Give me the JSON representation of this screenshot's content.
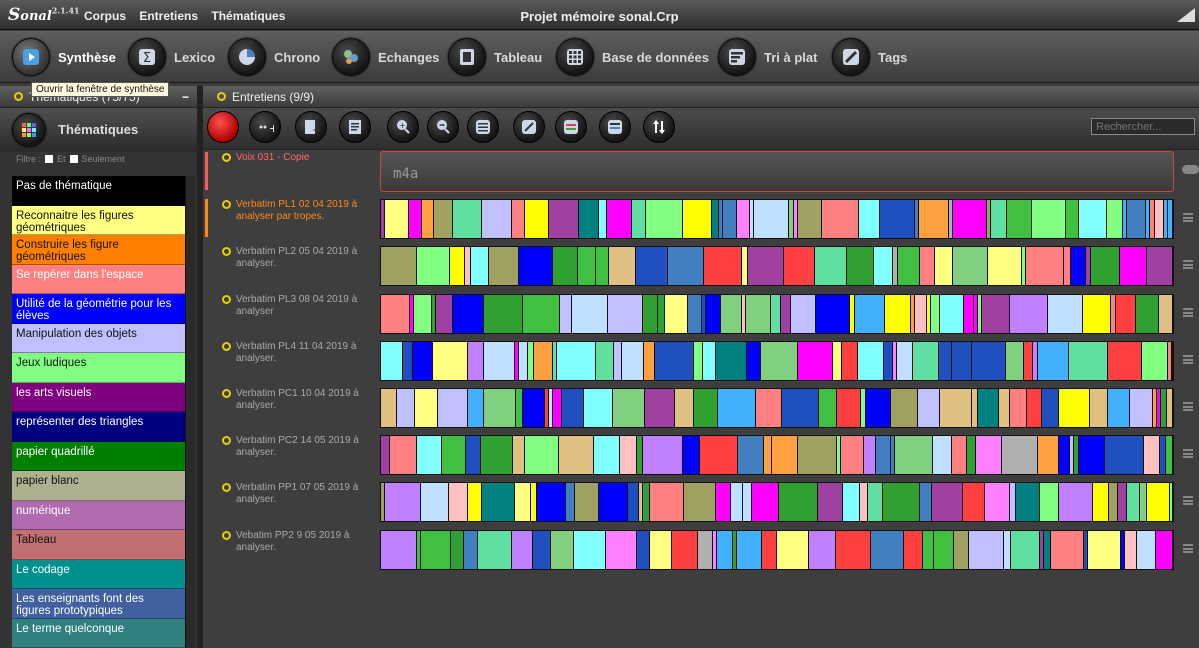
{
  "app": {
    "logo_s": "S",
    "logo_rest": "onal",
    "version": "2.1.41",
    "window_title": "Projet mémoire sonal.Crp",
    "menu": [
      "Corpus",
      "Entretiens",
      "Thématiques"
    ]
  },
  "toolbar": {
    "items": [
      {
        "label": "Synthèse",
        "icon": "synthese-icon",
        "active": true
      },
      {
        "label": "Lexico",
        "icon": "sigma-icon"
      },
      {
        "label": "Chrono",
        "icon": "chrono-pie-icon"
      },
      {
        "label": "Echanges",
        "icon": "people-icon"
      },
      {
        "label": "Tableau",
        "icon": "table-icon"
      },
      {
        "label": "Base de données",
        "icon": "database-grid-icon"
      },
      {
        "label": "Tri à plat",
        "icon": "bars-sort-icon"
      },
      {
        "label": "Tags",
        "icon": "tag-pen-icon"
      }
    ],
    "tooltip": "Ouvrir la fenêtre de synthèse"
  },
  "left_panel": {
    "header": "Thématiques (75/75)",
    "subheader": "Thématiques",
    "filter_label": "Filtre :",
    "filter_and": "Et",
    "filter_only": "Seulement",
    "themes": [
      {
        "label": "Pas de thématique",
        "color": "#000000"
      },
      {
        "label": "Reconnaitre les figures géométriques",
        "color": "#ffff80",
        "dark": true
      },
      {
        "label": "Construire les figure géométriques",
        "color": "#ff8000",
        "dark": true
      },
      {
        "label": "Se repérer dans l'espace",
        "color": "#ff8080"
      },
      {
        "label": "Utilité de la géométrie pour les élèves",
        "color": "#0000ff"
      },
      {
        "label": "Manipulation des objets",
        "color": "#c0c0ff",
        "dark": true
      },
      {
        "label": "Jeux ludiques",
        "color": "#80ff80",
        "dark": true
      },
      {
        "label": "les arts visuels",
        "color": "#800080"
      },
      {
        "label": "représenter des triangles",
        "color": "#000080"
      },
      {
        "label": "papier quadrillé",
        "color": "#008000"
      },
      {
        "label": "papier blanc",
        "color": "#b0b090",
        "dark": true
      },
      {
        "label": "numérique",
        "color": "#b06ab0"
      },
      {
        "label": "Tableau",
        "color": "#c07070",
        "dark": true
      },
      {
        "label": "Le codage",
        "color": "#009090"
      },
      {
        "label": "Les enseignants font des figures prototypiques",
        "color": "#4060a0"
      },
      {
        "label": "Le terme quelconque",
        "color": "#308080"
      }
    ]
  },
  "main_panel": {
    "header": "Entretiens (9/9)",
    "search_placeholder": "Rechercher...",
    "tools": [
      "record-icon",
      "add-interview-icon",
      "import-icon",
      "document-icon",
      "zoom-in-icon",
      "zoom-out-icon",
      "list-view-icon",
      "edit-view-icon",
      "expand-view-icon",
      "compact-view-icon",
      "sort-icon"
    ],
    "interviews": [
      {
        "label": "Voix 031 - Copie",
        "style": "red",
        "audio": "m4a"
      },
      {
        "label": "Verbatim PL1 02 04 2019 à analyser par tropes.",
        "style": "orange"
      },
      {
        "label": "Verbatim PL2 05 04 2019 à analyser."
      },
      {
        "label": "Verbatim PL3 08 04 2019 à analyser"
      },
      {
        "label": "Verbatim PL4 11 04 2019 à analyser."
      },
      {
        "label": "Verbatim PC1 10 04 2019 à analyser."
      },
      {
        "label": "Verbatim PC2 14 05 2019 à analyser."
      },
      {
        "label": "Verbatim PP1 07 05 2019 à analyser."
      },
      {
        "label": "Vebatim PP2 9 05 2019 à analyser."
      }
    ]
  }
}
